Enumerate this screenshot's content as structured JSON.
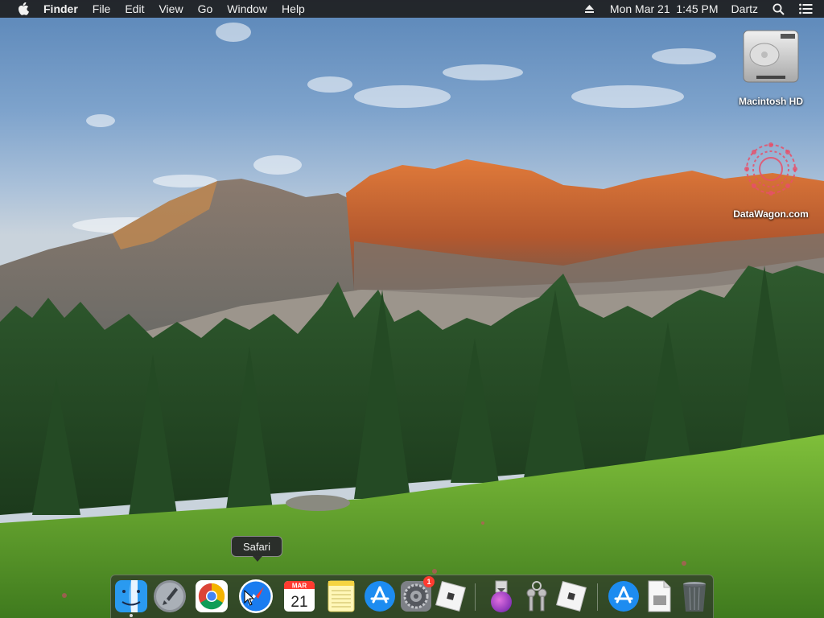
{
  "menubar": {
    "app_name": "Finder",
    "menus": [
      "File",
      "Edit",
      "View",
      "Go",
      "Window",
      "Help"
    ],
    "datetime": "Mon Mar 21  1:45 PM",
    "user": "Dartz"
  },
  "desktop": {
    "icons": [
      {
        "label": "Macintosh HD",
        "icon": "hard-drive-icon"
      },
      {
        "label": "DataWagon.com",
        "icon": "datawagon-logo-icon"
      }
    ]
  },
  "tooltip": {
    "text": "Safari"
  },
  "dock": {
    "items": [
      {
        "name": "Finder",
        "icon": "finder-icon",
        "running": true
      },
      {
        "name": "Launchpad",
        "icon": "launchpad-icon"
      },
      {
        "name": "Google Chrome",
        "icon": "chrome-icon"
      },
      {
        "name": "Safari",
        "icon": "safari-icon"
      },
      {
        "name": "Calendar",
        "icon": "calendar-icon",
        "month": "MAR",
        "day": "21"
      },
      {
        "name": "Notes",
        "icon": "notes-icon"
      },
      {
        "name": "App Store",
        "icon": "app-store-icon"
      },
      {
        "name": "System Preferences",
        "icon": "system-preferences-icon",
        "badge": "1"
      },
      {
        "name": "Roblox",
        "icon": "roblox-icon"
      },
      {
        "name": "Installer",
        "icon": "installer-icon"
      },
      {
        "name": "Keychain Access",
        "icon": "keychain-icon"
      },
      {
        "name": "Roblox Studio",
        "icon": "roblox-studio-icon"
      },
      {
        "name": "App Store Download",
        "icon": "app-store-download-icon"
      },
      {
        "name": "Document",
        "icon": "document-icon"
      },
      {
        "name": "Trash",
        "icon": "trash-icon"
      }
    ]
  },
  "colors": {
    "menubar_bg": "#1e1e20",
    "dock_bg": "#28282c",
    "badge": "#ff3b30",
    "safari_blue": "#1a7cf0"
  }
}
